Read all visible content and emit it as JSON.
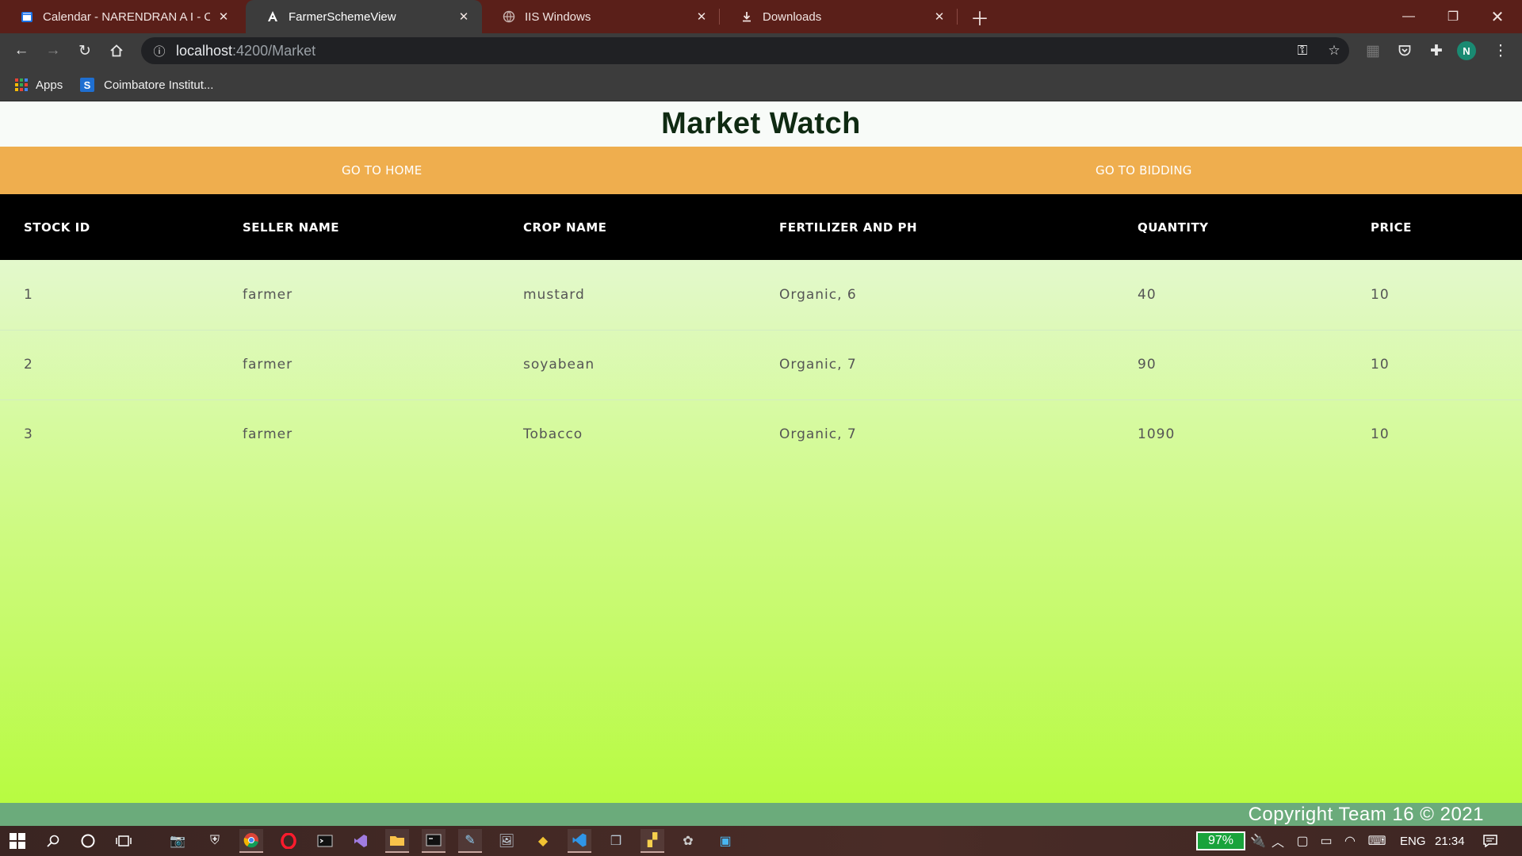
{
  "browser": {
    "tabs": [
      {
        "title": "Calendar - NARENDRAN A I - Ou",
        "favicon": "calendar-icon",
        "active": false
      },
      {
        "title": "FarmerSchemeView",
        "favicon": "angular-icon",
        "active": true
      },
      {
        "title": "IIS Windows",
        "favicon": "globe-icon",
        "active": false
      },
      {
        "title": "Downloads",
        "favicon": "download-icon",
        "active": false
      }
    ],
    "address": {
      "host": "localhost",
      "path": ":4200/Market"
    },
    "avatar_letter": "N",
    "bookmarks": [
      {
        "label": "Apps",
        "icon": "apps-grid-icon"
      },
      {
        "label": "Coimbatore Institut...",
        "icon": "site-s-icon"
      }
    ]
  },
  "page": {
    "title": "Market Watch",
    "nav": {
      "home": "GO TO HOME",
      "bidding": "GO TO BIDDING"
    },
    "table": {
      "headers": [
        "STOCK ID",
        "SELLER NAME",
        "CROP NAME",
        "FERTILIZER AND PH",
        "QUANTITY",
        "PRICE"
      ],
      "rows": [
        [
          "1",
          "farmer",
          "mustard",
          "Organic, 6",
          "40",
          "10"
        ],
        [
          "2",
          "farmer",
          "soyabean",
          "Organic, 7",
          "90",
          "10"
        ],
        [
          "3",
          "farmer",
          "Tobacco",
          "Organic, 7",
          "1090",
          "10"
        ]
      ]
    },
    "footer": "Copyright Team 16 © 2021"
  },
  "taskbar": {
    "battery": "97%",
    "language": "ENG",
    "time": "21:34"
  },
  "colors": {
    "tabstrip": "#5a1f19",
    "toolbar": "#3c3c3c",
    "nav_bar": "#efae4e",
    "table_header": "#000000",
    "footer": "#6bab7b",
    "gradient_bottom": "#b6fb3b"
  }
}
